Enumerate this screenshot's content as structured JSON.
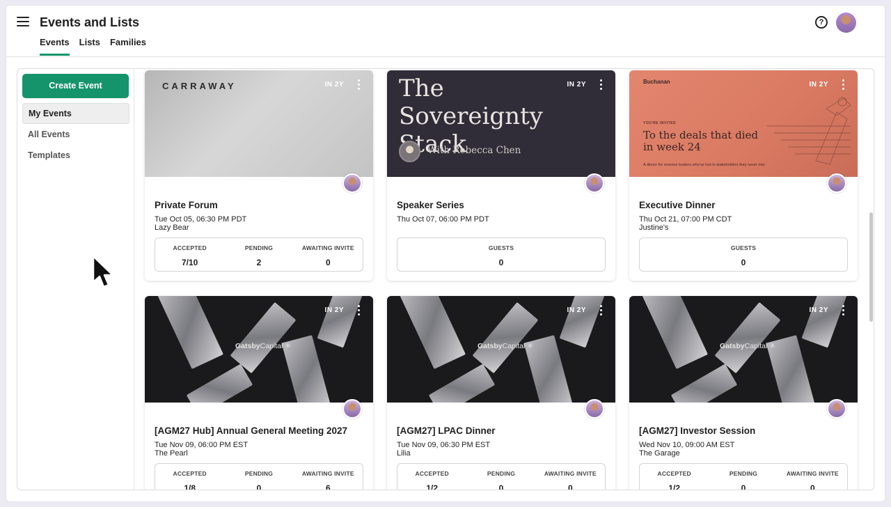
{
  "header": {
    "title": "Events and Lists",
    "tabs": [
      {
        "label": "Events",
        "active": true
      },
      {
        "label": "Lists",
        "active": false
      },
      {
        "label": "Families",
        "active": false
      }
    ],
    "help_icon": "help-circle-icon",
    "help_glyph": "?"
  },
  "sidebar": {
    "create_label": "Create Event",
    "items": [
      {
        "label": "My Events",
        "active": true
      },
      {
        "label": "All Events",
        "active": false
      },
      {
        "label": "Templates",
        "active": false
      }
    ]
  },
  "colors": {
    "accent": "#15946b",
    "speaker_banner": "#302c38",
    "buchanan_banner": "#e3866f"
  },
  "events": [
    {
      "title": "Private Forum",
      "when": "IN 2Y",
      "date": "Tue Oct 05, 06:30 PM PDT",
      "venue": "Lazy Bear",
      "banner": {
        "brand": "CARRAWAY"
      },
      "stats": [
        {
          "label": "ACCEPTED",
          "value": "7/10"
        },
        {
          "label": "PENDING",
          "value": "2"
        },
        {
          "label": "AWAITING INVITE",
          "value": "0"
        }
      ]
    },
    {
      "title": "Speaker Series",
      "when": "IN 2Y",
      "date": "Thu Oct 07, 06:00 PM PDT",
      "venue": "",
      "banner": {
        "headline": "The Sovereignty Stack",
        "with": "With Rebecca Chen"
      },
      "stats": [
        {
          "label": "GUESTS",
          "value": "0"
        }
      ]
    },
    {
      "title": "Executive Dinner",
      "when": "IN 2Y",
      "date": "Thu Oct 21, 07:00 PM CDT",
      "venue": "Justine's",
      "banner": {
        "logo": "Buchanan",
        "kicker": "YOU'RE INVITED",
        "headline": "To the deals that died in week 24",
        "sub": "A dinner for revenue leaders who've lost to stakeholders they never met"
      },
      "stats": [
        {
          "label": "GUESTS",
          "value": "0"
        }
      ]
    },
    {
      "title": "[AGM27 Hub] Annual General Meeting 2027",
      "when": "IN 2Y",
      "date": "Tue Nov 09, 06:00 PM EST",
      "venue": "The Pearl",
      "banner": {
        "brand_bold": "Gatsby",
        "brand_light": "Capital ✳"
      },
      "stats": [
        {
          "label": "ACCEPTED",
          "value": "1/8"
        },
        {
          "label": "PENDING",
          "value": "0"
        },
        {
          "label": "AWAITING INVITE",
          "value": "6"
        }
      ]
    },
    {
      "title": "[AGM27] LPAC Dinner",
      "when": "IN 2Y",
      "date": "Tue Nov 09, 06:30 PM EST",
      "venue": "Lilia",
      "banner": {
        "brand_bold": "Gatsby",
        "brand_light": "Capital ✳"
      },
      "stats": [
        {
          "label": "ACCEPTED",
          "value": "1/2"
        },
        {
          "label": "PENDING",
          "value": "0"
        },
        {
          "label": "AWAITING INVITE",
          "value": "0"
        }
      ]
    },
    {
      "title": "[AGM27] Investor Session",
      "when": "IN 2Y",
      "date": "Wed Nov 10, 09:00 AM EST",
      "venue": "The Garage",
      "banner": {
        "brand_bold": "Gatsby",
        "brand_light": "Capital ✳"
      },
      "stats": [
        {
          "label": "ACCEPTED",
          "value": "1/2"
        },
        {
          "label": "PENDING",
          "value": "0"
        },
        {
          "label": "AWAITING INVITE",
          "value": "0"
        }
      ]
    }
  ]
}
